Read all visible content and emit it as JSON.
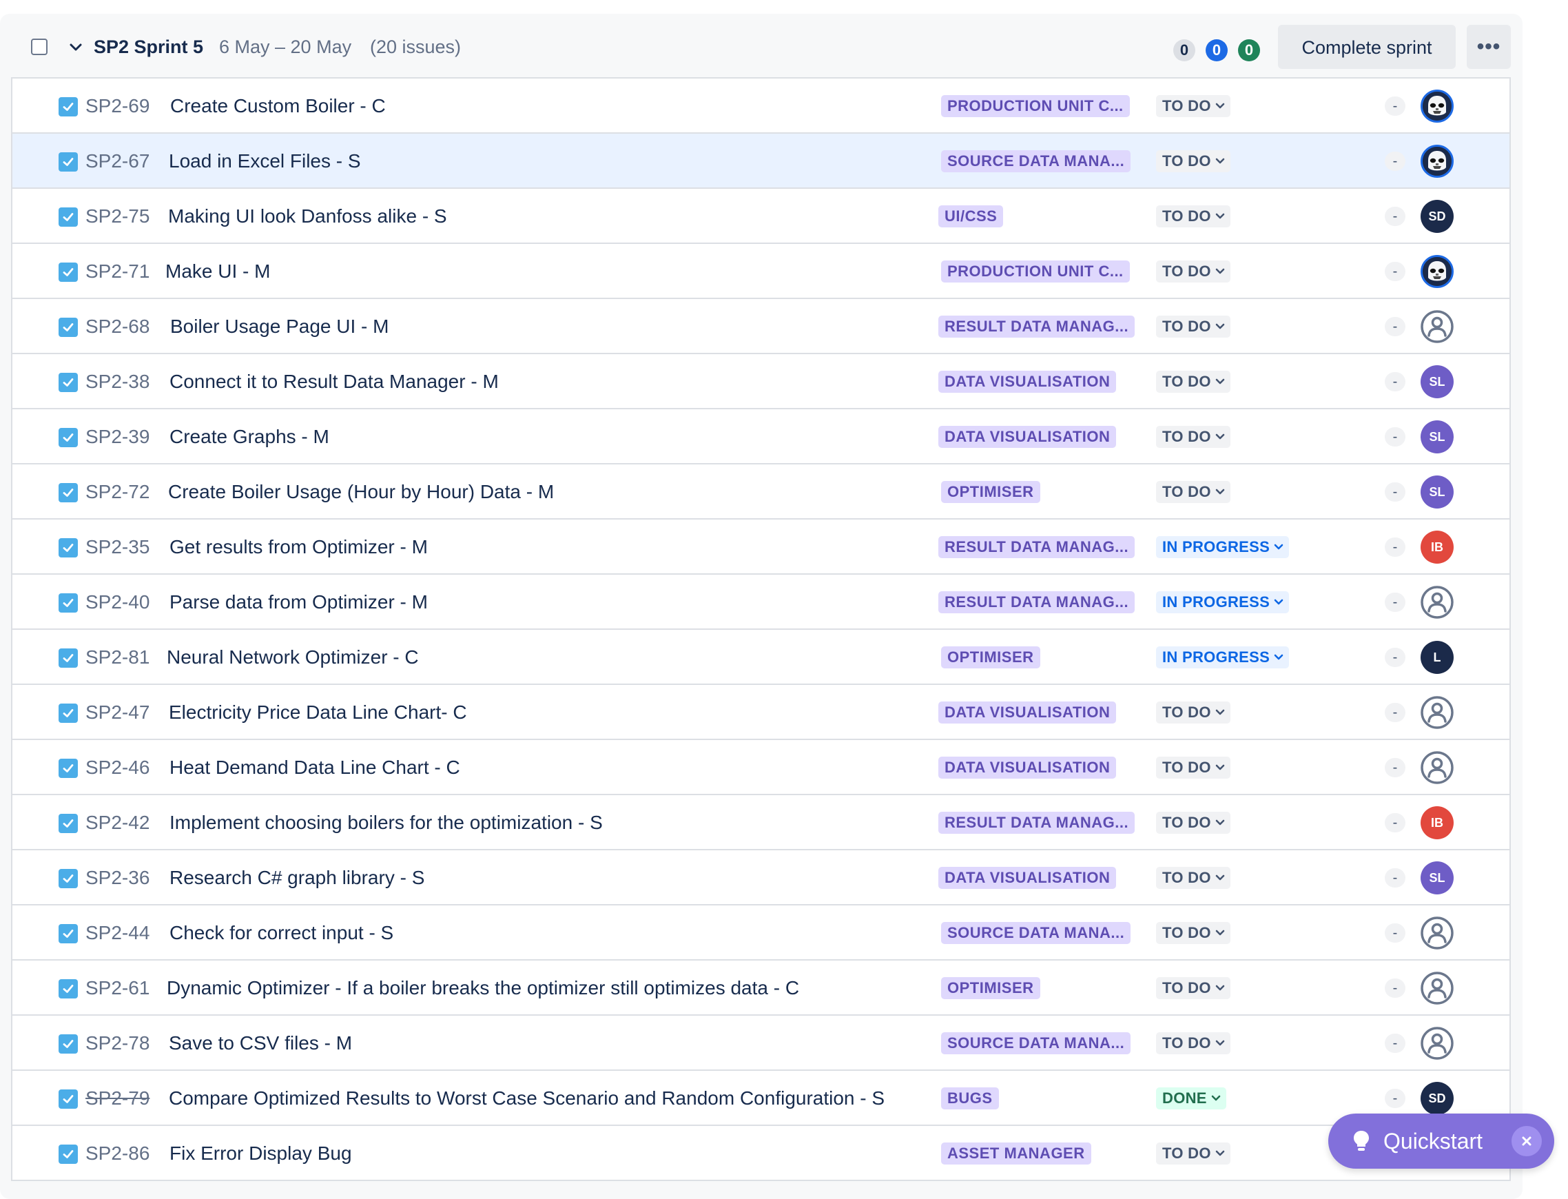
{
  "sprint": {
    "name": "SP2 Sprint 5",
    "dates": "6 May – 20 May",
    "issue_count": "(20 issues)",
    "counts": {
      "todo": "0",
      "in_progress": "0",
      "done": "0"
    },
    "complete_label": "Complete sprint",
    "more_label": "•••"
  },
  "colors": {
    "issue_type": "#4bade8",
    "epic_bg": "#dfd8fd",
    "epic_text": "#5e4db2",
    "in_progress": "#0c66e4",
    "done": "#216e4e",
    "avatar_sl": "#6e5dc6",
    "avatar_ib": "#e2483d",
    "avatar_dark": "#1b2a4a"
  },
  "issues": [
    {
      "key": "SP2-69",
      "summary": "Create Custom Boiler - C",
      "epic": "PRODUCTION UNIT C...",
      "status": "TO DO",
      "estimate": "-",
      "assignee": "photo"
    },
    {
      "key": "SP2-67",
      "summary": "Load in Excel Files - S",
      "epic": "SOURCE DATA MANA...",
      "status": "TO DO",
      "estimate": "-",
      "assignee": "photo"
    },
    {
      "key": "SP2-75",
      "summary": "Making UI look Danfoss alike - S",
      "epic": "UI/CSS",
      "status": "TO DO",
      "estimate": "-",
      "assignee": "SD"
    },
    {
      "key": "SP2-71",
      "summary": "Make UI - M",
      "epic": "PRODUCTION UNIT C...",
      "status": "TO DO",
      "estimate": "-",
      "assignee": "photo"
    },
    {
      "key": "SP2-68",
      "summary": "Boiler Usage Page UI - M",
      "epic": "RESULT DATA MANAG...",
      "status": "TO DO",
      "estimate": "-",
      "assignee": "unassigned"
    },
    {
      "key": "SP2-38",
      "summary": "Connect it to Result Data Manager - M",
      "epic": "DATA VISUALISATION",
      "status": "TO DO",
      "estimate": "-",
      "assignee": "SL"
    },
    {
      "key": "SP2-39",
      "summary": "Create Graphs - M",
      "epic": "DATA VISUALISATION",
      "status": "TO DO",
      "estimate": "-",
      "assignee": "SL"
    },
    {
      "key": "SP2-72",
      "summary": "Create Boiler Usage (Hour by Hour) Data - M",
      "epic": "OPTIMISER",
      "status": "TO DO",
      "estimate": "-",
      "assignee": "SL"
    },
    {
      "key": "SP2-35",
      "summary": "Get results from Optimizer - M",
      "epic": "RESULT DATA MANAG...",
      "status": "IN PROGRESS",
      "estimate": "-",
      "assignee": "IB"
    },
    {
      "key": "SP2-40",
      "summary": "Parse data from Optimizer - M",
      "epic": "RESULT DATA MANAG...",
      "status": "IN PROGRESS",
      "estimate": "-",
      "assignee": "unassigned"
    },
    {
      "key": "SP2-81",
      "summary": "Neural Network Optimizer - C",
      "epic": "OPTIMISER",
      "status": "IN PROGRESS",
      "estimate": "-",
      "assignee": "L"
    },
    {
      "key": "SP2-47",
      "summary": "Electricity Price Data Line Chart- C",
      "epic": "DATA VISUALISATION",
      "status": "TO DO",
      "estimate": "-",
      "assignee": "unassigned"
    },
    {
      "key": "SP2-46",
      "summary": "Heat Demand Data Line Chart - C",
      "epic": "DATA VISUALISATION",
      "status": "TO DO",
      "estimate": "-",
      "assignee": "unassigned"
    },
    {
      "key": "SP2-42",
      "summary": "Implement choosing boilers for the optimization - S",
      "epic": "RESULT DATA MANAG...",
      "status": "TO DO",
      "estimate": "-",
      "assignee": "IB"
    },
    {
      "key": "SP2-36",
      "summary": "Research C# graph library - S",
      "epic": "DATA VISUALISATION",
      "status": "TO DO",
      "estimate": "-",
      "assignee": "SL"
    },
    {
      "key": "SP2-44",
      "summary": "Check for correct input - S",
      "epic": "SOURCE DATA MANA...",
      "status": "TO DO",
      "estimate": "-",
      "assignee": "unassigned"
    },
    {
      "key": "SP2-61",
      "summary": "Dynamic Optimizer - If a boiler breaks the optimizer still optimizes data - C",
      "epic": "OPTIMISER",
      "status": "TO DO",
      "estimate": "-",
      "assignee": "unassigned"
    },
    {
      "key": "SP2-78",
      "summary": "Save to CSV files - M",
      "epic": "SOURCE DATA MANA...",
      "status": "TO DO",
      "estimate": "-",
      "assignee": "unassigned"
    },
    {
      "key": "SP2-79",
      "summary": "Compare Optimized Results to Worst Case Scenario and Random Configuration - S",
      "epic": "BUGS",
      "status": "DONE",
      "estimate": "-",
      "assignee": "SD"
    },
    {
      "key": "SP2-86",
      "summary": "Fix Error Display Bug",
      "epic": "ASSET MANAGER",
      "status": "TO DO",
      "estimate": "-",
      "assignee": "none"
    }
  ],
  "quickstart": {
    "label": "Quickstart"
  }
}
